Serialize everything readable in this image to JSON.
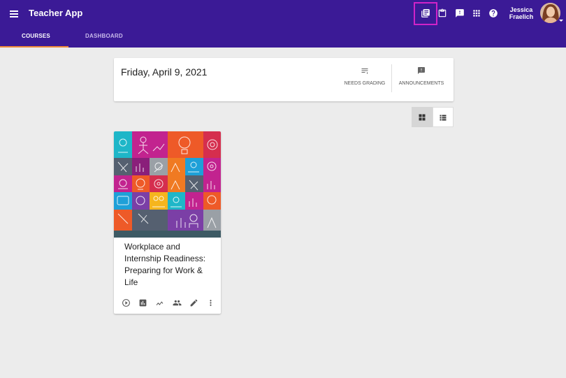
{
  "app": {
    "title": "Teacher App"
  },
  "user": {
    "name_line1": "Jessica",
    "name_line2": "Fraelich"
  },
  "tabs": [
    {
      "label": "COURSES",
      "active": true
    },
    {
      "label": "DASHBOARD",
      "active": false
    }
  ],
  "toolbar_icons": [
    "library-books-icon",
    "clipboard-icon",
    "feedback-icon",
    "apps-grid-icon",
    "help-icon"
  ],
  "date_card": {
    "date": "Friday, April 9, 2021",
    "needs_grading_label": "NEEDS GRADING",
    "announcements_label": "ANNOUNCEMENTS"
  },
  "view_toggle": {
    "selected": "grid"
  },
  "courses": [
    {
      "title": "Workplace and Internship Readiness: Preparing for Work & Life",
      "actions": [
        "play-icon",
        "bar-chart-icon",
        "trend-icon",
        "people-icon",
        "edit-icon",
        "more-vert-icon"
      ]
    }
  ],
  "colors": {
    "header": "#3b1a96",
    "tab_indicator": "#f08a3a",
    "highlight_border": "#d023c8",
    "background": "#ececec"
  }
}
